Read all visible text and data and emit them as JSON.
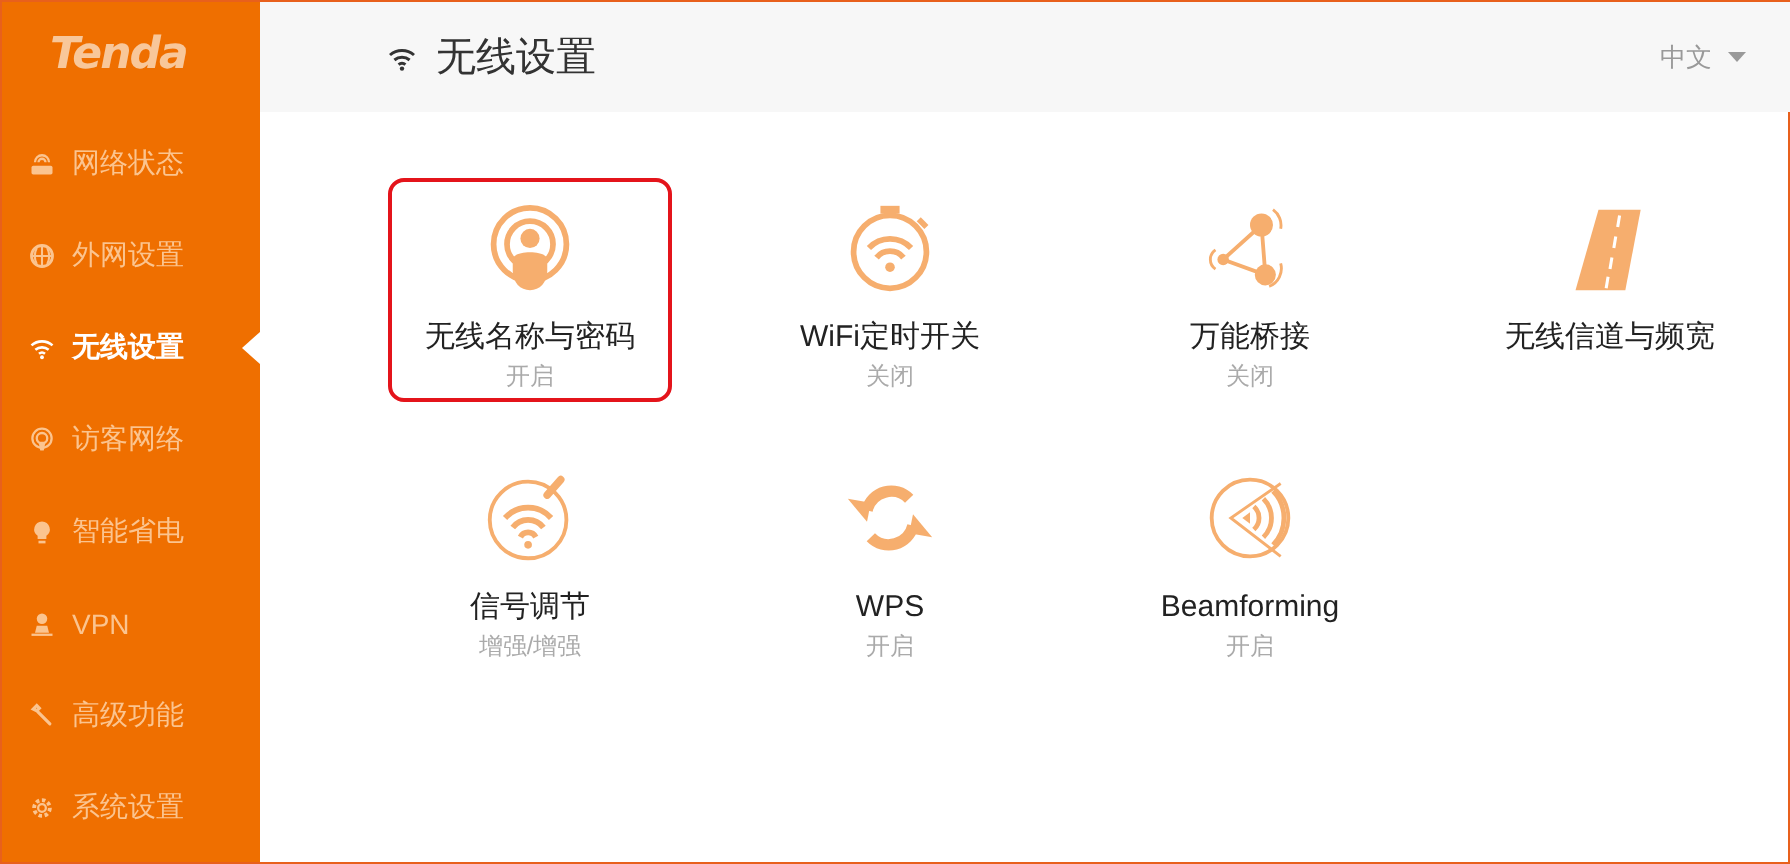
{
  "logo": "Tenda",
  "sidebar": {
    "items": [
      {
        "label": "网络状态",
        "selected": false
      },
      {
        "label": "外网设置",
        "selected": false
      },
      {
        "label": "无线设置",
        "selected": true
      },
      {
        "label": "访客网络",
        "selected": false
      },
      {
        "label": "智能省电",
        "selected": false
      },
      {
        "label": "VPN",
        "selected": false
      },
      {
        "label": "高级功能",
        "selected": false
      },
      {
        "label": "系统设置",
        "selected": false
      }
    ]
  },
  "header": {
    "title": "无线设置",
    "language": "中文"
  },
  "tiles": [
    {
      "label": "无线名称与密码",
      "status": "开启",
      "selected": true
    },
    {
      "label": "WiFi定时开关",
      "status": "关闭",
      "selected": false
    },
    {
      "label": "万能桥接",
      "status": "关闭",
      "selected": false
    },
    {
      "label": "无线信道与频宽",
      "selected": false
    },
    {
      "label": "信号调节",
      "status": "增强/增强",
      "selected": false
    },
    {
      "label": "WPS",
      "status": "开启",
      "selected": false
    },
    {
      "label": "Beamforming",
      "status": "开启",
      "selected": false
    }
  ]
}
